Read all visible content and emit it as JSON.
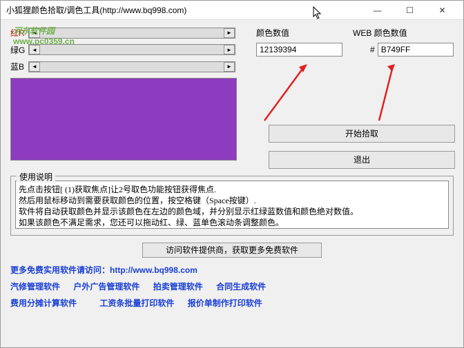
{
  "window": {
    "title": "小狐狸颜色拾取/调色工具(http://www.bq998.com)"
  },
  "watermark": {
    "main": "河东软件园",
    "sub": "www.pc0359.cn"
  },
  "sliders": {
    "red": "红R",
    "green": "绿G",
    "blue": "蓝B"
  },
  "labels": {
    "colorValue": "颜色数值",
    "webColorValue": "WEB 颜色数值",
    "hash": "#"
  },
  "values": {
    "decimal": "12139394",
    "hex": "B749FF"
  },
  "color": {
    "preview": "#8d3bbf"
  },
  "buttons": {
    "start": "开始拾取",
    "exit": "退出",
    "visit": "访问软件提供商，获取更多免费软件"
  },
  "fieldset": {
    "title": "使用说明"
  },
  "instructions": "先点击按钮[ (1)获取焦点]让2号取色功能按钮获得焦点.\n然后用鼠标移动到需要获取颜色的位置，按空格键（Space按键）.\n软件将自动获取颜色并显示该颜色在左边的颜色域，并分别显示红绿蓝数值和颜色绝对数值。\n如果该颜色不满足需求，您还可以拖动红、绿、蓝单色滚动条调整颜色。",
  "links": {
    "more": "更多免费实用软件请访问：",
    "url": "http://www.bq998.com",
    "row2": [
      "汽修管理软件",
      "户外广告管理软件",
      "拍卖管理软件",
      "合同生成软件"
    ],
    "row3": [
      "费用分摊计算软件",
      "工资条批量打印软件",
      "报价单制作打印软件"
    ]
  }
}
